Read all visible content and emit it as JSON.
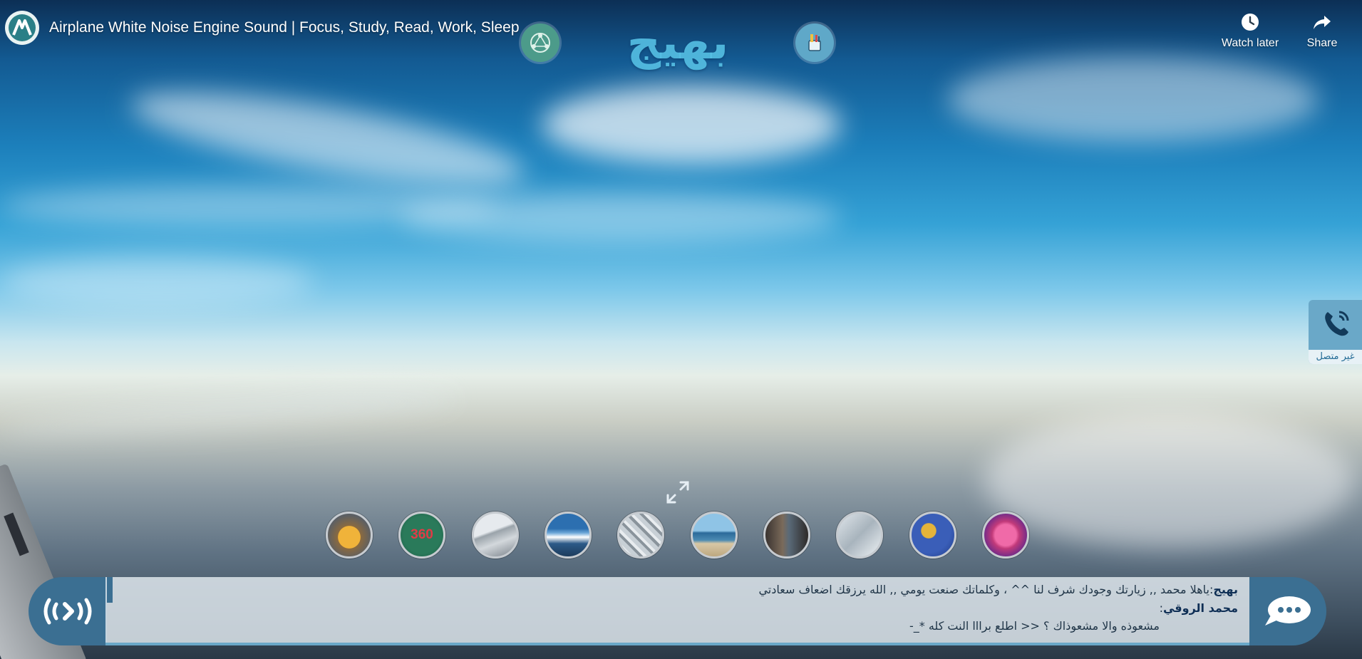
{
  "video": {
    "title": "Airplane White Noise Engine Sound | Focus, Study, Read, Work, Sleep",
    "channel_icon": "channel-logo-icon"
  },
  "site_logo": {
    "text": "بهيج"
  },
  "top_icons": {
    "left": "network-icon",
    "right": "tools-icon"
  },
  "actions": {
    "watch_later": "Watch later",
    "share": "Share"
  },
  "phone_widget": {
    "icon": "phone-icon",
    "status": "غير متصل"
  },
  "expand_icon": "expand-icon",
  "thumbnails": [
    {
      "name": "thumb-golden-animal",
      "label": ""
    },
    {
      "name": "thumb-360",
      "label": "360"
    },
    {
      "name": "thumb-snow-road",
      "label": ""
    },
    {
      "name": "thumb-aerial-earth",
      "label": ""
    },
    {
      "name": "thumb-crystals",
      "label": ""
    },
    {
      "name": "thumb-beach",
      "label": ""
    },
    {
      "name": "thumb-forest",
      "label": ""
    },
    {
      "name": "thumb-ice",
      "label": ""
    },
    {
      "name": "thumb-abstract-blue",
      "label": ""
    },
    {
      "name": "thumb-pink-jellyfish",
      "label": ""
    }
  ],
  "chat": {
    "left_icon": "broadcast-icon",
    "right_icon": "chat-bubble-icon",
    "messages": [
      {
        "author": "بهيج",
        "text": "ياهلا محمد ,, زيارتك وجودك شرف لنا ^^ ، وكلماتك صنعت يومي ,, الله يرزقك اضعاف سعادتي"
      },
      {
        "author": "محمد الروقي",
        "text": "مشعوذه والا مشعوذاك ؟ << اطلع برااا النت كله *_-"
      }
    ]
  }
}
